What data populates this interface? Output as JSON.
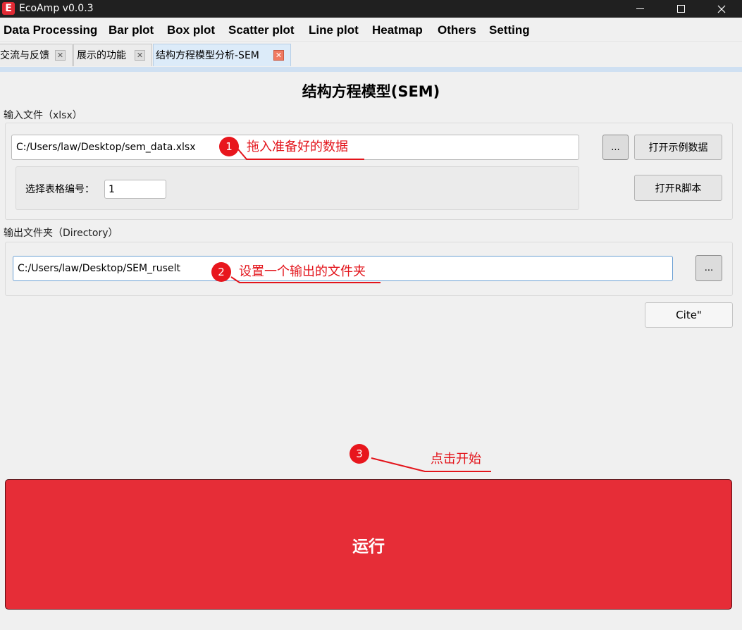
{
  "window": {
    "title": "EcoAmp v0.0.3",
    "logo_icon": "app-logo-icon",
    "logo_color": "#e12a34"
  },
  "menu": {
    "items": [
      "Data Processing",
      "Bar plot",
      "Box plot",
      "Scatter plot",
      "Line plot",
      "Heatmap",
      "Others",
      "Setting"
    ]
  },
  "tabs": [
    {
      "label": "交流与反馈",
      "active": false
    },
    {
      "label": "展示的功能",
      "active": false
    },
    {
      "label": "结构方程模型分析-SEM",
      "active": true
    }
  ],
  "main": {
    "heading": "结构方程模型(SEM)",
    "input_section": {
      "label": "输入文件（xlsx）",
      "file_path": "C:/Users/law/Desktop/sem_data.xlsx",
      "browse_label": "...",
      "example_button": "打开示例数据",
      "sheet_label": "选择表格编号：",
      "sheet_value": "1",
      "r_script_button": "打开R脚本"
    },
    "output_section": {
      "label": "输出文件夹（Directory）",
      "dir_path": "C:/Users/law/Desktop/SEM_ruselt",
      "browse_label": "..."
    },
    "cite_button": "Cite\"",
    "run_button": "运行",
    "run_color": "#e62d37"
  },
  "annotations": [
    {
      "number": "1",
      "text": "拖入准备好的数据"
    },
    {
      "number": "2",
      "text": "设置一个输出的文件夹"
    },
    {
      "number": "3",
      "text": "点击开始"
    }
  ],
  "annotation_color": "#e3141b"
}
